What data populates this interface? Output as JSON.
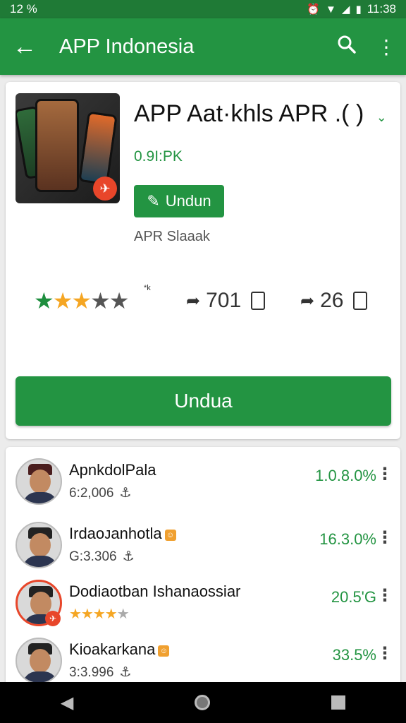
{
  "statusbar": {
    "left": "12 %",
    "time": "11:38"
  },
  "appbar": {
    "title": "APP Indonesia"
  },
  "app": {
    "title": "APP Aat·khls APR .(",
    "title_tail": ")",
    "size": "0.9I:PK",
    "install_small": "Undun",
    "developer": "APR Slaaak",
    "rating_sup": "*k",
    "stat1": "701",
    "stat2": "26",
    "install_big": "Undua"
  },
  "colors": {
    "primary": "#239442",
    "status": "#1f7a36",
    "star": "#f5a623"
  },
  "list": [
    {
      "name": "ApnkdolPala",
      "sub": "6:2,006",
      "version": "1.0.8.0%",
      "avatar": "person-fez"
    },
    {
      "name": "Irdaoᴊanhotla",
      "sub": "G:3.306",
      "version": "16.3.0%",
      "avatar": "person-peci",
      "tag": true
    },
    {
      "name": "Dodiaotban Ishanaossiar",
      "rating": 4,
      "version": "20.5'G",
      "avatar": "person-red-ring"
    },
    {
      "name": "Kioakarkana",
      "sub": "3:3.996",
      "version": "33.5%",
      "avatar": "person-peci",
      "tag": true
    }
  ]
}
